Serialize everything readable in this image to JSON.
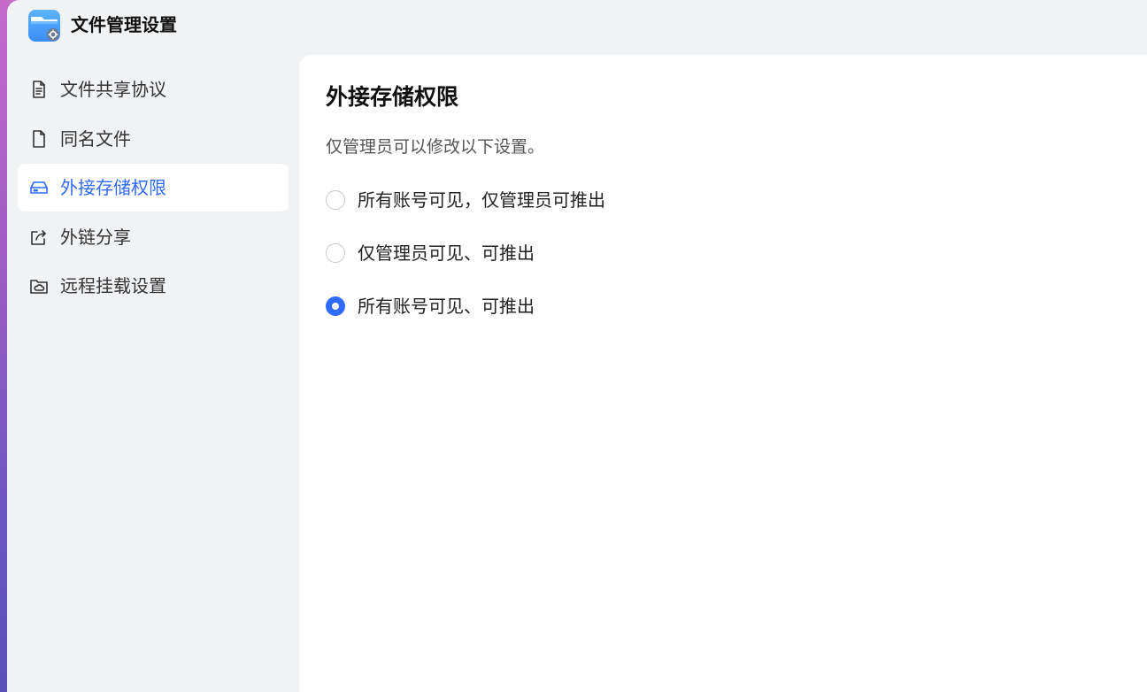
{
  "window": {
    "title": "文件管理设置"
  },
  "sidebar": {
    "items": [
      {
        "label": "文件共享协议",
        "icon": "document-icon",
        "active": false
      },
      {
        "label": "同名文件",
        "icon": "file-icon",
        "active": false
      },
      {
        "label": "外接存储权限",
        "icon": "external-drive-icon",
        "active": true
      },
      {
        "label": "外链分享",
        "icon": "share-icon",
        "active": false
      },
      {
        "label": "远程挂载设置",
        "icon": "cloud-folder-icon",
        "active": false
      }
    ]
  },
  "main": {
    "title": "外接存储权限",
    "description": "仅管理员可以修改以下设置。",
    "options": [
      {
        "label": "所有账号可见，仅管理员可推出",
        "selected": false
      },
      {
        "label": "仅管理员可见、可推出",
        "selected": false
      },
      {
        "label": "所有账号可见、可推出",
        "selected": true
      }
    ]
  },
  "colors": {
    "accent": "#2f6bff",
    "window_bg": "#f1f2f4",
    "panel_bg": "#ffffff"
  }
}
